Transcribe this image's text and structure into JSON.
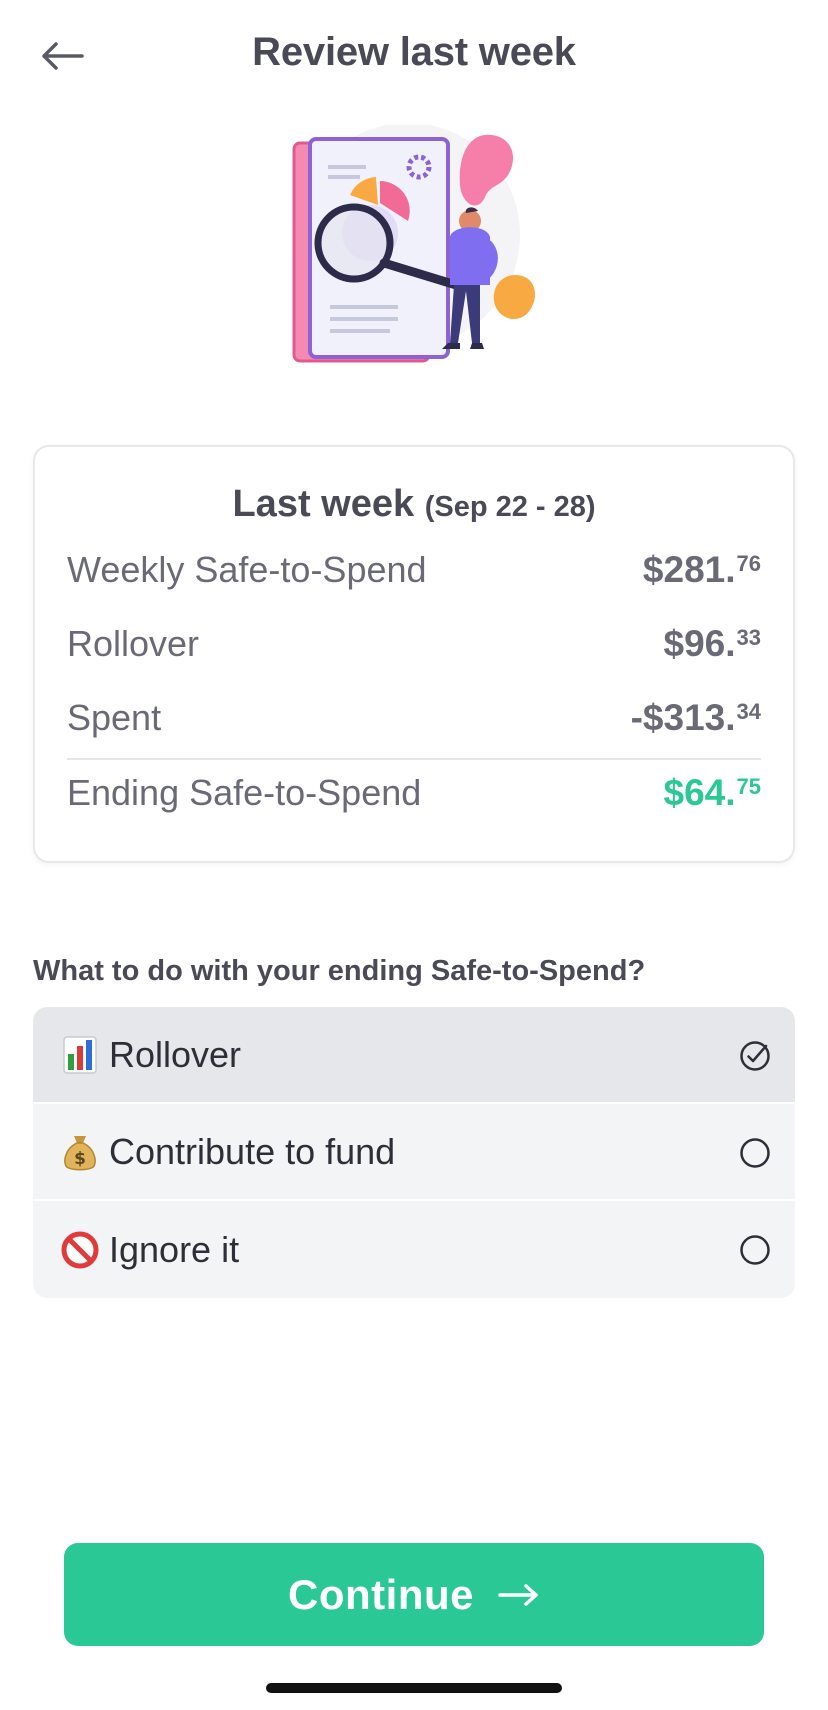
{
  "header": {
    "title": "Review last week",
    "back_icon": "arrow-left-icon"
  },
  "hero": {
    "illustration": "report-magnifier-illustration"
  },
  "summary": {
    "title": "Last week",
    "date_range": "(Sep 22 - 28)",
    "rows": [
      {
        "label": "Weekly Safe-to-Spend",
        "whole": "$281.",
        "cents": "76"
      },
      {
        "label": "Rollover",
        "whole": "$96.",
        "cents": "33"
      },
      {
        "label": "Spent",
        "whole": "-$313.",
        "cents": "34"
      },
      {
        "label": "Ending Safe-to-Spend",
        "whole": "$64.",
        "cents": "75"
      }
    ]
  },
  "question": "What to do with your ending Safe-to-Spend?",
  "options": [
    {
      "label": "Rollover",
      "icon": "bar-chart-icon",
      "selected": true
    },
    {
      "label": "Contribute to fund",
      "icon": "money-bag-icon",
      "selected": false
    },
    {
      "label": "Ignore it",
      "icon": "prohibited-icon",
      "selected": false
    }
  ],
  "continue_button": {
    "label": "Continue",
    "icon": "arrow-right-icon"
  },
  "colors": {
    "accent": "#29c895",
    "text": "#4a4a56",
    "muted": "#6a6a76",
    "option_bg": "#f3f4f6",
    "option_selected_bg": "#e6e7ea"
  }
}
